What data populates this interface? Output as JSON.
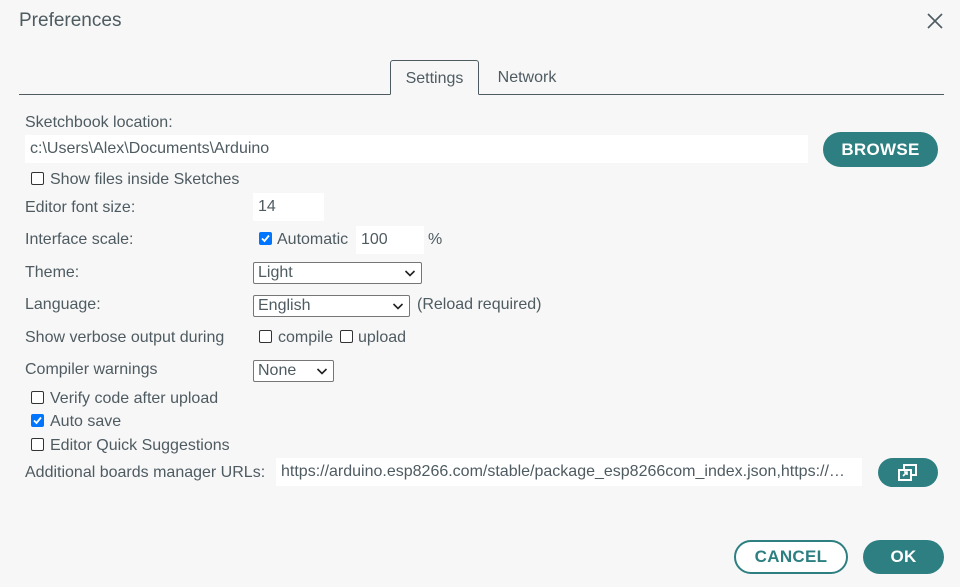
{
  "window": {
    "title": "Preferences"
  },
  "tabs": [
    {
      "label": "Settings",
      "active": true
    },
    {
      "label": "Network",
      "active": false
    }
  ],
  "sketchbook": {
    "label": "Sketchbook location:",
    "value": "c:\\Users\\Alex\\Documents\\Arduino",
    "browse_label": "BROWSE"
  },
  "show_files": {
    "label": "Show files inside Sketches",
    "checked": false
  },
  "editor_font_size": {
    "label": "Editor font size:",
    "value": "14"
  },
  "interface_scale": {
    "label": "Interface scale:",
    "automatic_label": "Automatic",
    "automatic_checked": true,
    "value": "100",
    "unit": "%"
  },
  "theme": {
    "label": "Theme:",
    "selected": "Light"
  },
  "language": {
    "label": "Language:",
    "selected": "English",
    "note": "(Reload required)"
  },
  "verbose": {
    "label": "Show verbose output during",
    "compile_label": "compile",
    "compile_checked": false,
    "upload_label": "upload",
    "upload_checked": false
  },
  "compiler_warnings": {
    "label": "Compiler warnings",
    "selected": "None"
  },
  "verify_code": {
    "label": "Verify code after upload",
    "checked": false
  },
  "auto_save": {
    "label": "Auto save",
    "checked": true
  },
  "quick_suggestions": {
    "label": "Editor Quick Suggestions",
    "checked": false
  },
  "boards_urls": {
    "label": "Additional boards manager URLs:",
    "value": "https://arduino.esp8266.com/stable/package_esp8266com_index.json,https://…"
  },
  "footer": {
    "cancel_label": "CANCEL",
    "ok_label": "OK"
  },
  "colors": {
    "accent": "#2e7f81",
    "text": "#4e5b61",
    "background": "#f7f7f7",
    "checkbox": "#0075ff"
  }
}
